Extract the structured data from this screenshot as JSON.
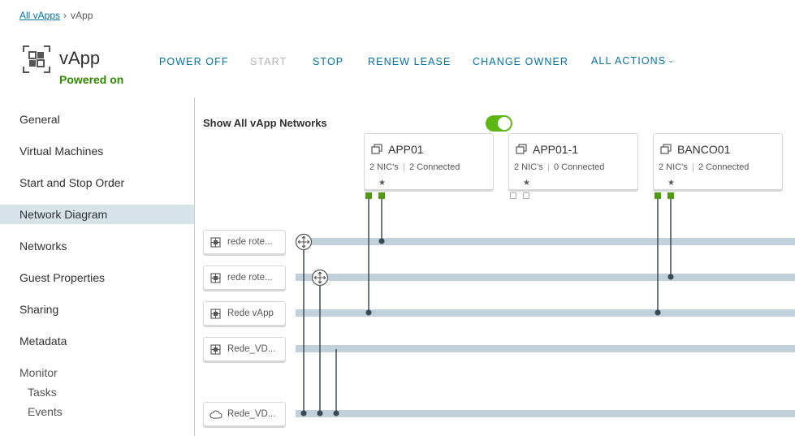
{
  "breadcrumb": {
    "root": "All vApps",
    "current": "vApp"
  },
  "header": {
    "title": "vApp",
    "status": "Powered on"
  },
  "actions": [
    {
      "label": "POWER OFF",
      "disabled": false
    },
    {
      "label": "START",
      "disabled": true
    },
    {
      "label": "STOP",
      "disabled": false
    },
    {
      "label": "RENEW LEASE",
      "disabled": false
    },
    {
      "label": "CHANGE OWNER",
      "disabled": false
    },
    {
      "label": "ALL ACTIONS",
      "disabled": false
    }
  ],
  "sidebar": {
    "items": [
      {
        "label": "General"
      },
      {
        "label": "Virtual Machines"
      },
      {
        "label": "Start and Stop Order"
      },
      {
        "label": "Network Diagram",
        "active": true
      },
      {
        "label": "Networks"
      },
      {
        "label": "Guest Properties"
      },
      {
        "label": "Sharing"
      },
      {
        "label": "Metadata"
      }
    ],
    "monitor": {
      "label": "Monitor",
      "items": [
        {
          "label": "Tasks"
        },
        {
          "label": "Events"
        }
      ]
    }
  },
  "diagram": {
    "toggle_label": "Show All vApp Networks",
    "toggle_on": true,
    "vms": [
      {
        "name": "APP01",
        "nics": "2 NIC's",
        "connected": "2 Connected"
      },
      {
        "name": "APP01-1",
        "nics": "2 NIC's",
        "connected": "0 Connected"
      },
      {
        "name": "BANCO01",
        "nics": "2 NIC's",
        "connected": "2 Connected"
      }
    ],
    "networks": [
      {
        "name": "rede rote..."
      },
      {
        "name": "rede rote..."
      },
      {
        "name": "Rede vApp"
      },
      {
        "name": "Rede_VD..."
      },
      {
        "name": "Rede_VD..."
      }
    ]
  },
  "colors": {
    "accent": "#0072a3",
    "status_green": "#318700",
    "toggle_green": "#5eb715",
    "nic_connected": "#4f9a12",
    "network_bar": "#c2d0d9",
    "connector": "#3a4a55"
  },
  "icons": {
    "header": "vapp-grid-icon",
    "vm": "vm-icon",
    "network": "network-icon",
    "external_network": "cloud-icon",
    "router": "router-icon",
    "primary_nic": "star-icon",
    "dropdown": "chevron-down-icon"
  }
}
